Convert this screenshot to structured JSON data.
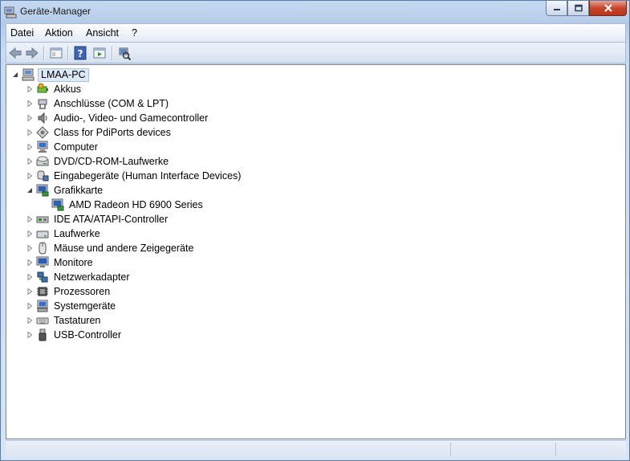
{
  "window": {
    "title": "Geräte-Manager",
    "colors": {
      "frame": "#c5d9f1",
      "close": "#c8452c",
      "selection": "#dde9f7"
    }
  },
  "menu": [
    "Datei",
    "Aktion",
    "Ansicht",
    "?"
  ],
  "toolbar": {
    "buttons": [
      "back-icon",
      "forward-icon",
      "properties-icon",
      "help-icon",
      "view-icon",
      "scan-hardware-icon"
    ]
  },
  "tree": {
    "root": {
      "label": "LMAA-PC",
      "expanded": true
    },
    "items": [
      {
        "label": "Akkus",
        "icon": "battery-icon",
        "expanded": false
      },
      {
        "label": "Anschlüsse (COM & LPT)",
        "icon": "port-icon",
        "expanded": false
      },
      {
        "label": "Audio-, Video- und Gamecontroller",
        "icon": "speaker-icon",
        "expanded": false
      },
      {
        "label": "Class for PdiPorts devices",
        "icon": "device-class-icon",
        "expanded": false
      },
      {
        "label": "Computer",
        "icon": "computer-icon",
        "expanded": false
      },
      {
        "label": "DVD/CD-ROM-Laufwerke",
        "icon": "dvd-drive-icon",
        "expanded": false
      },
      {
        "label": "Eingabegeräte (Human Interface Devices)",
        "icon": "hid-icon",
        "expanded": false
      },
      {
        "label": "Grafikkarte",
        "icon": "display-adapter-icon",
        "expanded": true,
        "children": [
          {
            "label": "AMD Radeon HD 6900 Series",
            "icon": "display-adapter-icon"
          }
        ]
      },
      {
        "label": "IDE ATA/ATAPI-Controller",
        "icon": "ide-controller-icon",
        "expanded": false
      },
      {
        "label": "Laufwerke",
        "icon": "disk-drive-icon",
        "expanded": false
      },
      {
        "label": "Mäuse und andere Zeigegeräte",
        "icon": "mouse-icon",
        "expanded": false
      },
      {
        "label": "Monitore",
        "icon": "monitor-icon",
        "expanded": false
      },
      {
        "label": "Netzwerkadapter",
        "icon": "network-adapter-icon",
        "expanded": false
      },
      {
        "label": "Prozessoren",
        "icon": "processor-icon",
        "expanded": false
      },
      {
        "label": "Systemgeräte",
        "icon": "system-devices-icon",
        "expanded": false
      },
      {
        "label": "Tastaturen",
        "icon": "keyboard-icon",
        "expanded": false
      },
      {
        "label": "USB-Controller",
        "icon": "usb-icon",
        "expanded": false
      }
    ]
  }
}
